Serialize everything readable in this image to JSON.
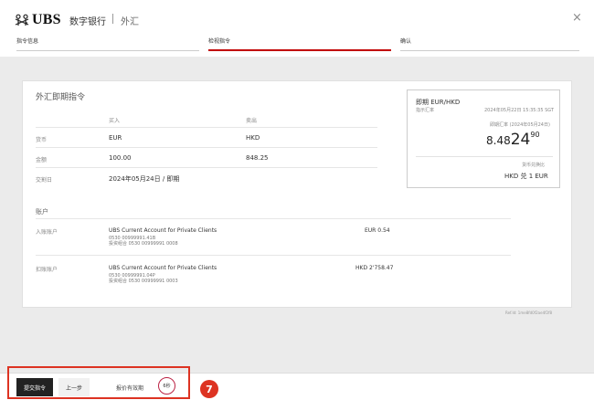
{
  "header": {
    "logo_text": "UBS",
    "app_name": "数字银行",
    "section": "外汇",
    "close_symbol": "×"
  },
  "stepper": {
    "steps": [
      {
        "label": "指令信息",
        "active": false
      },
      {
        "label": "检视指令",
        "active": true
      },
      {
        "label": "确认",
        "active": false
      }
    ]
  },
  "order": {
    "title": "外汇即期指令",
    "col_buy": "买入",
    "col_sell": "卖出",
    "currency_label": "货币",
    "currency_buy": "EUR",
    "currency_sell": "HKD",
    "amount_label": "金额",
    "amount_buy": "100.00",
    "amount_sell": "848.25",
    "value_date_label": "交割日",
    "value_date": "2024年05月24日 / 即期",
    "accounts_title": "账户",
    "credit_label": "入账账户",
    "credit_name": "UBS Current Account for Private Clients",
    "credit_no": "0530 00999991.41B",
    "credit_portfolio": "投资组合 0530 00999991 0008",
    "credit_balance": "EUR 0.54",
    "debit_label": "扣账账户",
    "debit_name": "UBS Current Account for Private Clients",
    "debit_no": "0530 00999991.04P",
    "debit_portfolio": "投资组合 0530 00999991 0003",
    "debit_balance": "HKD 2'758.47"
  },
  "rate": {
    "title": "即期 EUR/HKD",
    "rate_type": "指示汇率",
    "timestamp": "2024年05月22日 15:35:35 SGT",
    "value_date_note": "即期汇率 (2024年05月24日)",
    "rate_a": "8.48",
    "rate_b": "24",
    "rate_c": "90",
    "convert_label": "货币兑换比",
    "convert_text": "HKD 兑 1 EUR"
  },
  "reference": "Ref.Id: 1me8fd0f2ae4f2f8",
  "footer": {
    "submit": "提交指令",
    "back": "上一步",
    "expire": "报价有效期",
    "timer": "6秒",
    "annotation": "7"
  },
  "colors": {
    "accent": "#c20000",
    "annotation": "#dd3322"
  }
}
